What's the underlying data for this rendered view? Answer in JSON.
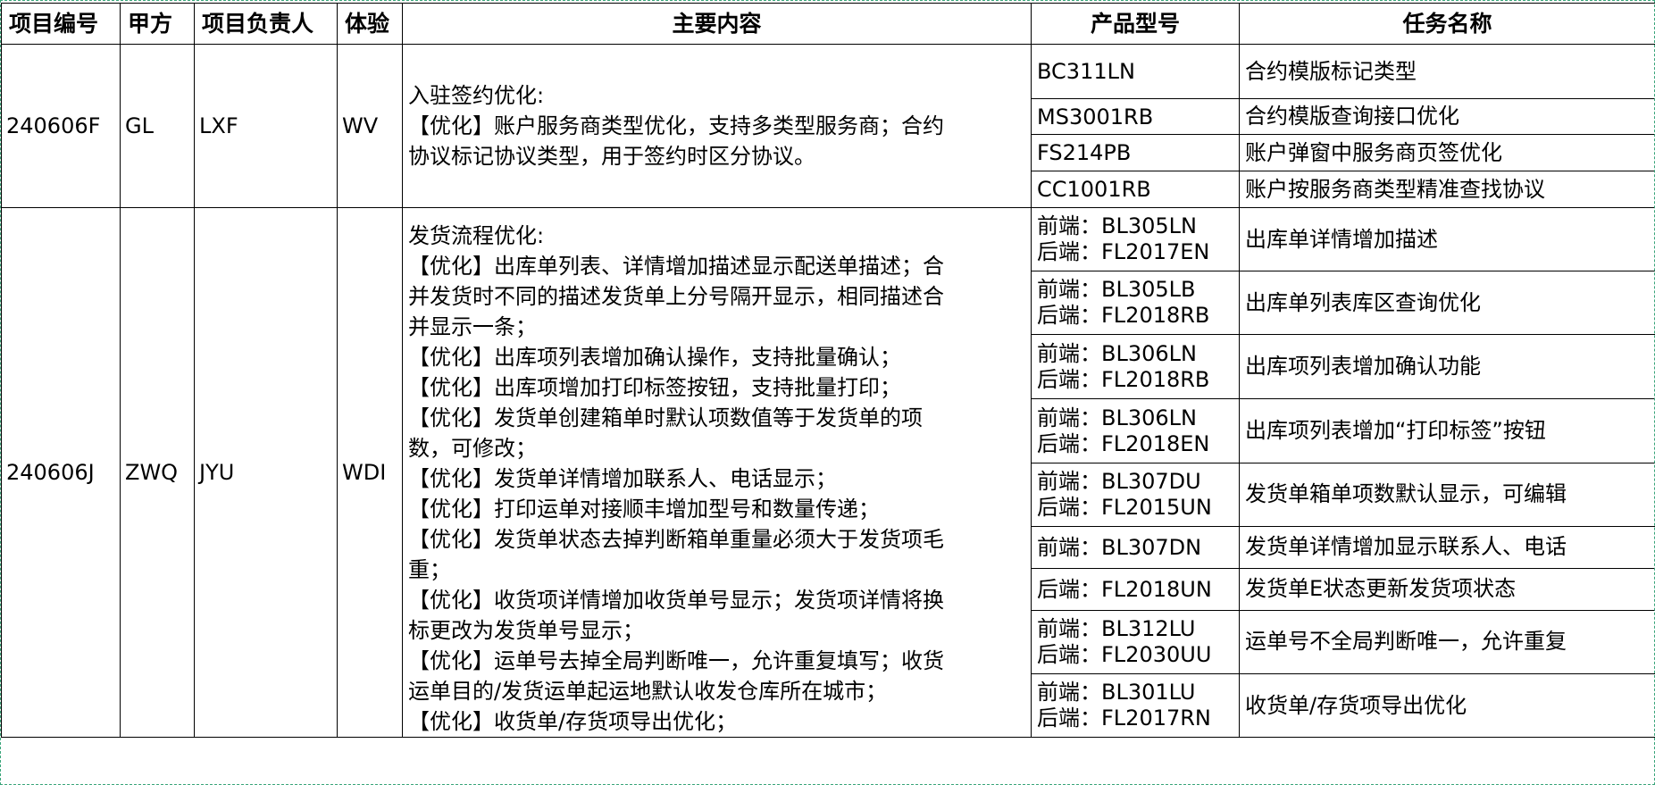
{
  "headers": {
    "project_id": "项目编号",
    "party_a": "甲方",
    "owner": "项目负责人",
    "experience": "体验",
    "content": "主要内容",
    "model": "产品型号",
    "task": "任务名称"
  },
  "projects": [
    {
      "project_id": "240606F",
      "party_a": "GL",
      "owner": "LXF",
      "experience": "WV",
      "content_lines": [
        "入驻签约优化:",
        "【优化】账户服务商类型优化，支持多类型服务商；合约",
        "协议标记协议类型，用于签约时区分协议。"
      ],
      "tasks": [
        {
          "model_lines": [
            "BC311LN"
          ],
          "task": "合约模版标记类型"
        },
        {
          "model_lines": [
            "MS3001RB"
          ],
          "task": "合约模版查询接口优化"
        },
        {
          "model_lines": [
            "FS214PB"
          ],
          "task": "账户弹窗中服务商页签优化"
        },
        {
          "model_lines": [
            "CC1001RB"
          ],
          "task": "账户按服务商类型精准查找协议"
        }
      ]
    },
    {
      "project_id": "240606J",
      "party_a": "ZWQ",
      "owner": "JYU",
      "experience": "WDI",
      "content_lines": [
        "发货流程优化:",
        "【优化】出库单列表、详情增加描述显示配送单描述；合",
        "并发货时不同的描述发货单上分号隔开显示，相同描述合",
        "并显示一条；",
        "【优化】出库项列表增加确认操作，支持批量确认；",
        "【优化】出库项增加打印标签按钮，支持批量打印；",
        "【优化】发货单创建箱单时默认项数值等于发货单的项",
        "数，可修改；",
        "【优化】发货单详情增加联系人、电话显示；",
        "【优化】打印运单对接顺丰增加型号和数量传递；",
        "【优化】发货单状态去掉判断箱单重量必须大于发货项毛",
        "重；",
        "【优化】收货项详情增加收货单号显示；发货项详情将换",
        "标更改为发货单号显示；",
        "【优化】运单号去掉全局判断唯一，允许重复填写；收货",
        "运单目的/发货运单起运地默认收发仓库所在城市；",
        "【优化】收货单/存货项导出优化；"
      ],
      "tasks": [
        {
          "model_lines": [
            "前端：BL305LN",
            "后端：FL2017EN"
          ],
          "task": "出库单详情增加描述"
        },
        {
          "model_lines": [
            "前端：BL305LB",
            "后端：FL2018RB"
          ],
          "task": "出库单列表库区查询优化"
        },
        {
          "model_lines": [
            "前端：BL306LN",
            "后端：FL2018RB"
          ],
          "task": "出库项列表增加确认功能"
        },
        {
          "model_lines": [
            "前端：BL306LN",
            "后端：FL2018EN"
          ],
          "task": "出库项列表增加“打印标签”按钮"
        },
        {
          "model_lines": [
            "前端：BL307DU",
            "后端：FL2015UN"
          ],
          "task": "发货单箱单项数默认显示，可编辑"
        },
        {
          "model_lines": [
            "前端：BL307DN"
          ],
          "task": "发货单详情增加显示联系人、电话"
        },
        {
          "model_lines": [
            "后端：FL2018UN"
          ],
          "task": "发货单E状态更新发货项状态"
        },
        {
          "model_lines": [
            "前端：BL312LU",
            "后端：FL2030UU"
          ],
          "task": "运单号不全局判断唯一，允许重复"
        },
        {
          "model_lines": [
            "前端：BL301LU",
            "后端：FL2017RN"
          ],
          "task": "收货单/存货项导出优化"
        }
      ]
    }
  ]
}
